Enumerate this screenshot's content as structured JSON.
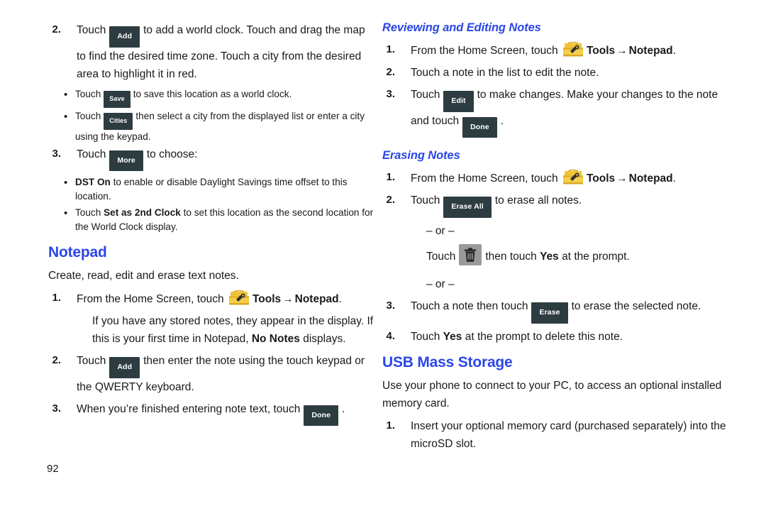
{
  "document": {
    "page_number": "92",
    "accent_color": "#2b46e8",
    "key_color": "#2d3c40",
    "trash_key_color": "#9a9a9a"
  },
  "left_column": {
    "step2": {
      "number": "2.",
      "text_before_key": "Touch",
      "key_add": "Add",
      "text_after_key": "to add a world clock. Touch and drag the map to find the desired time zone. Touch a city from the desired area to highlight it in red."
    },
    "bullet_save": {
      "dot": "•",
      "text_before_key": "Touch",
      "key_save": "Save",
      "text_after_key": "to save this location as a world clock."
    },
    "bullet_cities": {
      "dot": "•",
      "text_before_key": "Touch",
      "key_cities": "Cities",
      "text_after_key": "then select a city from the displayed list or enter a city using the keypad."
    },
    "step3": {
      "number": "3.",
      "text_before_key": "Touch",
      "key_more": "More",
      "text_after_key": "to choose:"
    },
    "bullet_dst": {
      "dot": "•",
      "bold_term": "DST On",
      "text": " to enable or disable Daylight Savings time offset to this location."
    },
    "bullet_2nd_clock": {
      "dot": "•",
      "text_before_bold": "Touch ",
      "bold_term": "Set as 2nd Clock",
      "text_after_bold": " to set this location as the second location for the World Clock display."
    },
    "notepad": {
      "heading": "Notepad",
      "intro": "Create, read, edit and erase text notes.",
      "step1": {
        "number": "1.",
        "text_before_icon": "From the Home Screen, touch",
        "icon": "toolbox-icon",
        "bold_tools": "Tools",
        "arrow": "→",
        "bold_notepad": "Notepad",
        "period": "."
      },
      "step1_note_a": "If you have any stored notes, they appear in the display. If this is your first time in Notepad, ",
      "step1_note_bold": "No Notes",
      "step1_note_b": " displays.",
      "step2": {
        "number": "2.",
        "text_before_key": "Touch",
        "key_add": "Add",
        "text_after_key": "then enter the note using the touch keypad or the QWERTY keyboard."
      },
      "step3": {
        "number": "3.",
        "text_before_key": "When you’re finished entering note text, touch",
        "key_done": "Done",
        "text_after_key": "."
      }
    }
  },
  "right_column": {
    "reviewing": {
      "heading": "Reviewing and Editing Notes",
      "step1": {
        "number": "1.",
        "text_before_icon": "From the Home Screen, touch",
        "icon": "toolbox-icon",
        "bold_tools": "Tools",
        "arrow": "→",
        "bold_notepad": "Notepad",
        "period": "."
      },
      "step2": {
        "number": "2.",
        "text": "Touch a note in the list to edit the note."
      },
      "step3": {
        "number": "3.",
        "text_before_key": "Touch",
        "key_edit": "Edit",
        "text_mid": "to make changes. Make your changes to the note and touch",
        "key_done": "Done",
        "text_after_key": "."
      }
    },
    "erasing": {
      "heading": "Erasing Notes",
      "step1": {
        "number": "1.",
        "text_before_icon": "From the Home Screen, touch",
        "icon": "toolbox-icon",
        "bold_tools": "Tools",
        "arrow": "→",
        "bold_notepad": "Notepad",
        "period": "."
      },
      "step2": {
        "number": "2.",
        "text_before_key": "Touch",
        "key_erase_all": "Erase All",
        "text_after_key": "to erase all notes."
      },
      "or_1": "– or –",
      "trash_line": {
        "text_before_key": "Touch",
        "icon": "trash-icon",
        "text_mid": "then touch ",
        "bold_yes": "Yes",
        "text_after": " at the prompt."
      },
      "or_2": "– or –",
      "step3": {
        "number": "3.",
        "text_before_key": "Touch a note then touch",
        "key_erase": "Erase",
        "text_after_key": "to erase the selected note."
      },
      "step4": {
        "number": "4.",
        "text_before_bold": "Touch ",
        "bold_yes": "Yes",
        "text_after_bold": " at the prompt to delete this note."
      }
    },
    "usb": {
      "heading": "USB Mass Storage",
      "intro": "Use your phone to connect to your PC, to access an optional installed memory card.",
      "step1": {
        "number": "1.",
        "text": "Insert your optional memory card (purchased separately) into the microSD slot."
      }
    }
  }
}
